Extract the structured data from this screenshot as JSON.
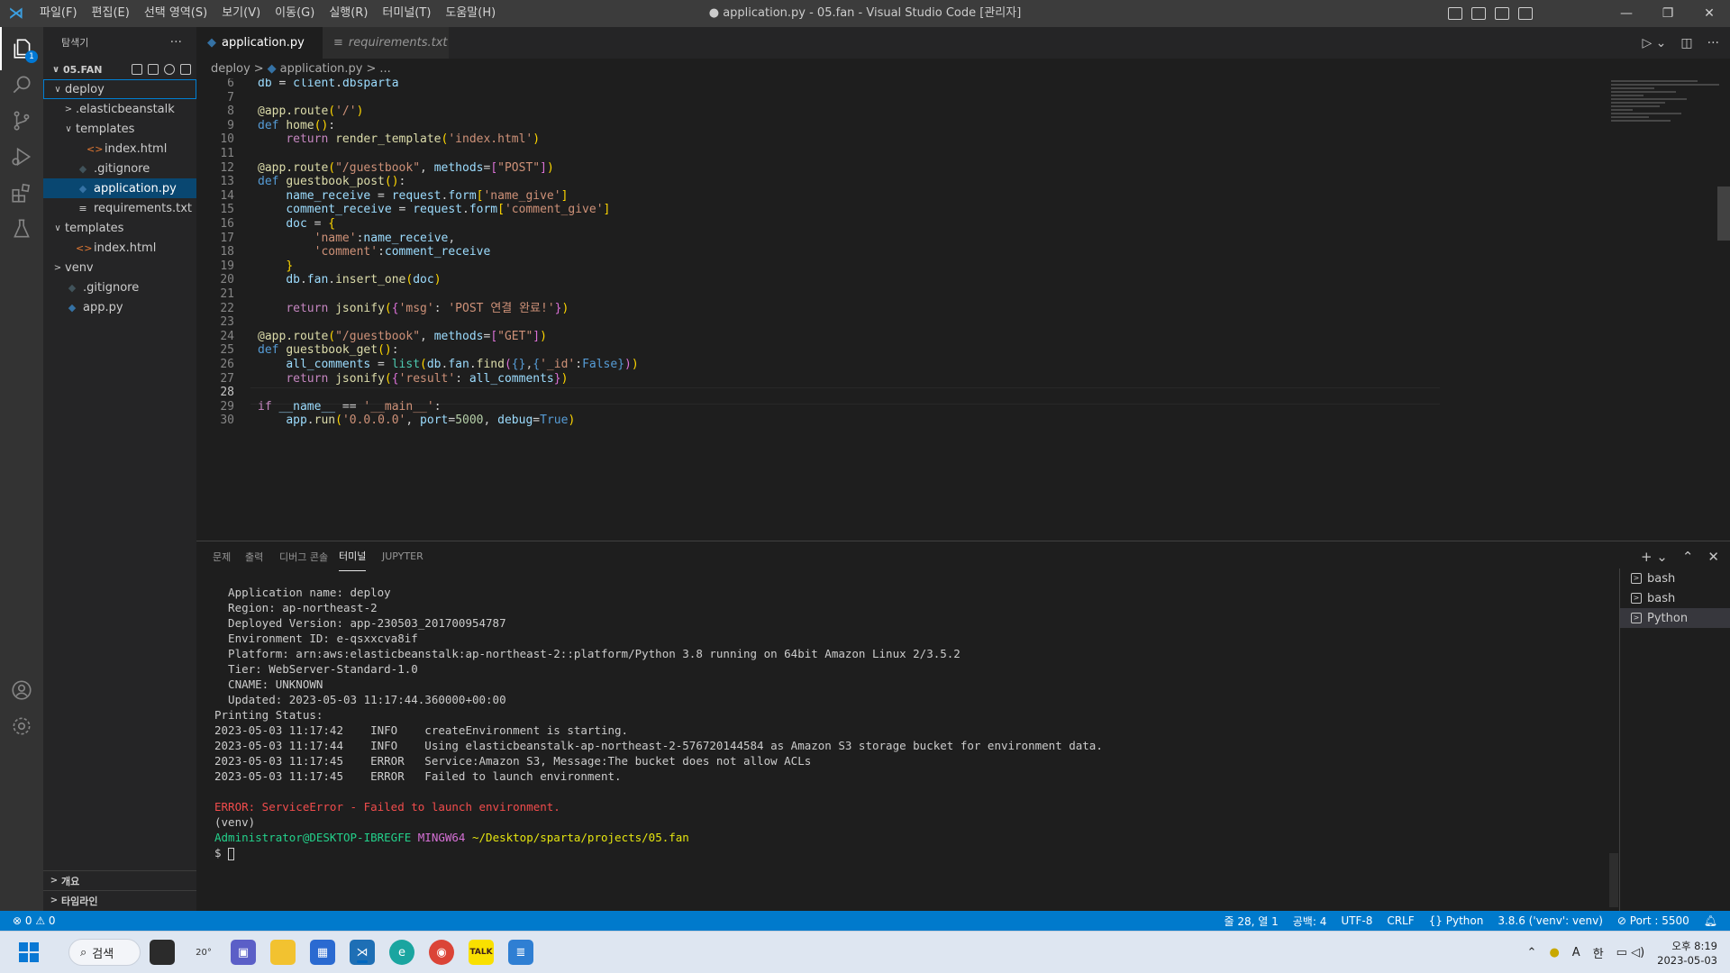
{
  "titlebar": {
    "menu": [
      "파일(F)",
      "편집(E)",
      "선택 영역(S)",
      "보기(V)",
      "이동(G)",
      "실행(R)",
      "터미널(T)",
      "도움말(H)"
    ],
    "title": "● application.py - 05.fan - Visual Studio Code [관리자]",
    "controls": [
      "—",
      "❐",
      "✕"
    ]
  },
  "activity": {
    "explorer_badge": "1"
  },
  "sidebar": {
    "header": "탐색기",
    "more": "···",
    "root": "05.FAN",
    "tree": [
      {
        "label": "deploy",
        "depth": 0,
        "chevron": "∨",
        "icon": "",
        "focus": true
      },
      {
        "label": ".elasticbeanstalk",
        "depth": 1,
        "chevron": ">",
        "icon": ""
      },
      {
        "label": "templates",
        "depth": 1,
        "chevron": "∨",
        "icon": ""
      },
      {
        "label": "index.html",
        "depth": 2,
        "chevron": "",
        "icon": "<>",
        "iconColor": "#e37933"
      },
      {
        "label": ".gitignore",
        "depth": 1,
        "chevron": "",
        "icon": "◆",
        "iconColor": "#41535b"
      },
      {
        "label": "application.py",
        "depth": 1,
        "chevron": "",
        "icon": "◆",
        "iconColor": "#3572a5",
        "selected": true
      },
      {
        "label": "requirements.txt",
        "depth": 1,
        "chevron": "",
        "icon": "≡",
        "iconColor": "#cccccc"
      },
      {
        "label": "templates",
        "depth": 0,
        "chevron": "∨",
        "icon": ""
      },
      {
        "label": "index.html",
        "depth": 1,
        "chevron": "",
        "icon": "<>",
        "iconColor": "#e37933"
      },
      {
        "label": "venv",
        "depth": 0,
        "chevron": ">",
        "icon": ""
      },
      {
        "label": ".gitignore",
        "depth": 0,
        "chevron": "",
        "icon": "◆",
        "iconColor": "#41535b"
      },
      {
        "label": "app.py",
        "depth": 0,
        "chevron": "",
        "icon": "◆",
        "iconColor": "#3572a5"
      }
    ],
    "outline": "개요",
    "timeline": "타임라인"
  },
  "tabs": [
    {
      "label": "application.py",
      "active": true,
      "dirty": true
    },
    {
      "label": "requirements.txt",
      "active": false
    }
  ],
  "breadcrumb": [
    "deploy",
    ">",
    "application.py",
    ">",
    "..."
  ],
  "editor": {
    "current_line": 28,
    "lines": [
      {
        "n": 6,
        "html": "<span class='v'>db</span> <span class='p'>=</span> <span class='v'>client</span>.<span class='v'>dbsparta</span>"
      },
      {
        "n": 7,
        "html": ""
      },
      {
        "n": 8,
        "html": "<span class='f'>@app.route</span><span class='y'>(</span><span class='s'>'/'</span><span class='y'>)</span>"
      },
      {
        "n": 9,
        "html": "<span class='k'>def</span> <span class='f'>home</span><span class='y'>()</span>:"
      },
      {
        "n": 10,
        "html": "    <span class='kc'>return</span> <span class='f'>render_template</span><span class='y'>(</span><span class='s'>'index.html'</span><span class='y'>)</span>"
      },
      {
        "n": 11,
        "html": ""
      },
      {
        "n": 12,
        "html": "<span class='f'>@app.route</span><span class='y'>(</span><span class='s'>\"/guestbook\"</span>, <span class='v'>methods</span>=<span class='m'>[</span><span class='s'>\"POST\"</span><span class='m'>]</span><span class='y'>)</span>"
      },
      {
        "n": 13,
        "html": "<span class='k'>def</span> <span class='f'>guestbook_post</span><span class='y'>()</span>:"
      },
      {
        "n": 14,
        "html": "    <span class='v'>name_receive</span> = <span class='v'>request</span>.<span class='v'>form</span><span class='y'>[</span><span class='s'>'name_give'</span><span class='y'>]</span>"
      },
      {
        "n": 15,
        "html": "    <span class='v'>comment_receive</span> = <span class='v'>request</span>.<span class='v'>form</span><span class='y'>[</span><span class='s'>'comment_give'</span><span class='y'>]</span>"
      },
      {
        "n": 16,
        "html": "    <span class='v'>doc</span> = <span class='y'>{</span>"
      },
      {
        "n": 17,
        "html": "        <span class='s'>'name'</span>:<span class='v'>name_receive</span>,"
      },
      {
        "n": 18,
        "html": "        <span class='s'>'comment'</span>:<span class='v'>comment_receive</span>"
      },
      {
        "n": 19,
        "html": "    <span class='y'>}</span>"
      },
      {
        "n": 20,
        "html": "    <span class='v'>db</span>.<span class='v'>fan</span>.<span class='f'>insert_one</span><span class='y'>(</span><span class='v'>doc</span><span class='y'>)</span>"
      },
      {
        "n": 21,
        "html": ""
      },
      {
        "n": 22,
        "html": "    <span class='kc'>return</span> <span class='f'>jsonify</span><span class='y'>(</span><span class='m'>{</span><span class='s'>'msg'</span>: <span class='s'>'POST 연결 완료!'</span><span class='m'>}</span><span class='y'>)</span>"
      },
      {
        "n": 23,
        "html": ""
      },
      {
        "n": 24,
        "html": "<span class='f'>@app.route</span><span class='y'>(</span><span class='s'>\"/guestbook\"</span>, <span class='v'>methods</span>=<span class='m'>[</span><span class='s'>\"GET\"</span><span class='m'>]</span><span class='y'>)</span>"
      },
      {
        "n": 25,
        "html": "<span class='k'>def</span> <span class='f'>guestbook_get</span><span class='y'>()</span>:"
      },
      {
        "n": 26,
        "html": "    <span class='v'>all_comments</span> = <span class='t'>list</span><span class='y'>(</span><span class='v'>db</span>.<span class='v'>fan</span>.<span class='f'>find</span><span class='m'>(</span><span class='k'>{}</span>,<span class='k'>{</span><span class='s'>'_id'</span>:<span class='k'>False</span><span class='k'>}</span><span class='m'>)</span><span class='y'>)</span>"
      },
      {
        "n": 27,
        "html": "    <span class='kc'>return</span> <span class='f'>jsonify</span><span class='y'>(</span><span class='m'>{</span><span class='s'>'result'</span>: <span class='v'>all_comments</span><span class='m'>}</span><span class='y'>)</span>"
      },
      {
        "n": 28,
        "html": ""
      },
      {
        "n": 29,
        "html": "<span class='kc'>if</span> <span class='v'>__name__</span> == <span class='s'>'__main__'</span>:"
      },
      {
        "n": 30,
        "html": "    <span class='v'>app</span>.<span class='f'>run</span><span class='y'>(</span><span class='s'>'0.0.0.0'</span>, <span class='v'>port</span>=<span class='n'>5000</span>, <span class='v'>debug</span>=<span class='k'>True</span><span class='y'>)</span>"
      }
    ]
  },
  "panel": {
    "tabs": [
      {
        "label": "문제",
        "active": false
      },
      {
        "label": "출력",
        "active": false
      },
      {
        "label": "디버그 콘솔",
        "active": false
      },
      {
        "label": "터미널",
        "active": true
      },
      {
        "label": "JUPYTER",
        "active": false
      }
    ],
    "terminal_lines": [
      {
        "text": "  Application name: deploy",
        "cls": ""
      },
      {
        "text": "  Region: ap-northeast-2",
        "cls": ""
      },
      {
        "text": "  Deployed Version: app-230503_201700954787",
        "cls": ""
      },
      {
        "text": "  Environment ID: e-qsxxcva8if",
        "cls": ""
      },
      {
        "text": "  Platform: arn:aws:elasticbeanstalk:ap-northeast-2::platform/Python 3.8 running on 64bit Amazon Linux 2/3.5.2",
        "cls": ""
      },
      {
        "text": "  Tier: WebServer-Standard-1.0",
        "cls": ""
      },
      {
        "text": "  CNAME: UNKNOWN",
        "cls": ""
      },
      {
        "text": "  Updated: 2023-05-03 11:17:44.360000+00:00",
        "cls": ""
      },
      {
        "text": "Printing Status:",
        "cls": ""
      },
      {
        "text": "2023-05-03 11:17:42    INFO    createEnvironment is starting.",
        "cls": ""
      },
      {
        "text": "2023-05-03 11:17:44    INFO    Using elasticbeanstalk-ap-northeast-2-576720144584 as Amazon S3 storage bucket for environment data.",
        "cls": ""
      },
      {
        "text": "2023-05-03 11:17:45    ERROR   Service:Amazon S3, Message:The bucket does not allow ACLs",
        "cls": ""
      },
      {
        "text": "2023-05-03 11:17:45    ERROR   Failed to launch environment.",
        "cls": ""
      },
      {
        "text": "",
        "cls": ""
      },
      {
        "text": "ERROR: ServiceError - Failed to launch environment.",
        "cls": "err"
      },
      {
        "text": "(venv)",
        "cls": ""
      }
    ],
    "prompt_user": "Administrator@DESKTOP-IBREGFE",
    "prompt_env": "MINGW64",
    "prompt_path": "~/Desktop/sparta/projects/05.fan",
    "prompt_symbol": "$ ",
    "terminals": [
      {
        "label": "bash",
        "selected": false
      },
      {
        "label": "bash",
        "selected": false
      },
      {
        "label": "Python",
        "selected": true
      }
    ]
  },
  "statusbar": {
    "problems": "⊗ 0 ⚠ 0",
    "items": [
      "줄 28, 열 1",
      "공백: 4",
      "UTF-8",
      "CRLF",
      "{} Python",
      "3.8.6 ('venv': venv)",
      "⊘ Port : 5500"
    ]
  },
  "taskbar": {
    "search": "검색",
    "weather": "20°",
    "kakao": "TALK",
    "time": "오후 8:19",
    "date": "2023-05-03",
    "ime": "한",
    "ime2": "A"
  }
}
